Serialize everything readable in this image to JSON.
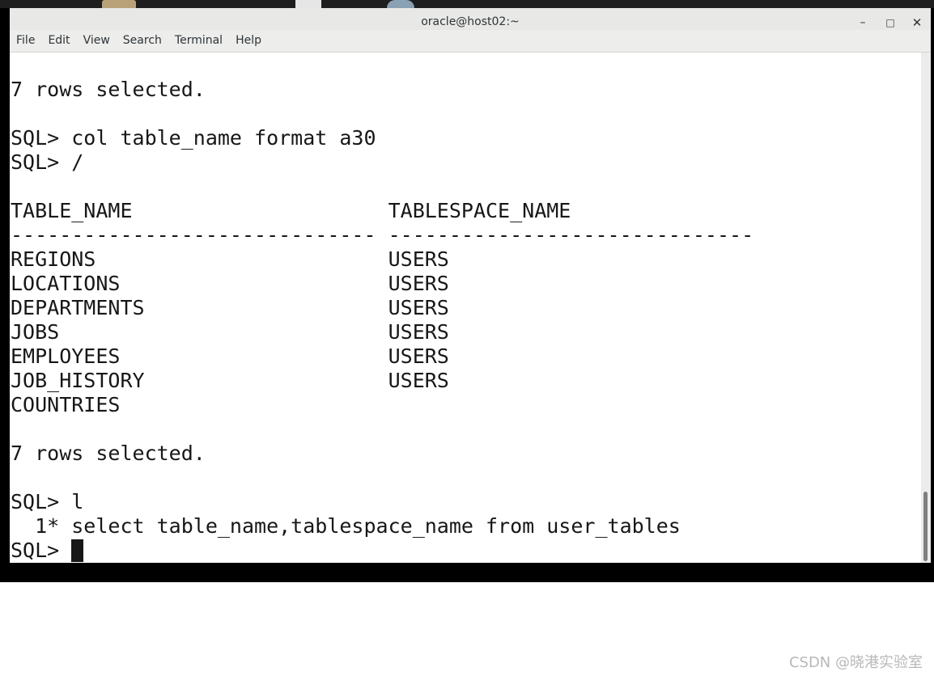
{
  "window": {
    "title": "oracle@host02:~",
    "controls": {
      "minimize": "–",
      "maximize": "□",
      "close": "✕"
    }
  },
  "menu": [
    "File",
    "Edit",
    "View",
    "Search",
    "Terminal",
    "Help"
  ],
  "terminal": {
    "lines": [
      "",
      "7 rows selected.",
      "",
      "SQL> col table_name format a30",
      "SQL> /",
      "",
      "TABLE_NAME                     TABLESPACE_NAME",
      "------------------------------ ------------------------------",
      "REGIONS                        USERS",
      "LOCATIONS                      USERS",
      "DEPARTMENTS                    USERS",
      "JOBS                           USERS",
      "EMPLOYEES                      USERS",
      "JOB_HISTORY                    USERS",
      "COUNTRIES",
      "",
      "7 rows selected.",
      "",
      "SQL> l",
      "  1* select table_name,tablespace_name from user_tables",
      "SQL> "
    ],
    "prompt": "SQL> "
  },
  "desktop_icons": [
    "folder-icon",
    "document-icon",
    "disk-icon"
  ],
  "colors": {
    "terminal_bg": "#ffffff",
    "terminal_fg": "#171717",
    "titlebar_bg": "#e8e8e7",
    "frame": "#000000"
  },
  "watermark": "CSDN @晓港实验室"
}
